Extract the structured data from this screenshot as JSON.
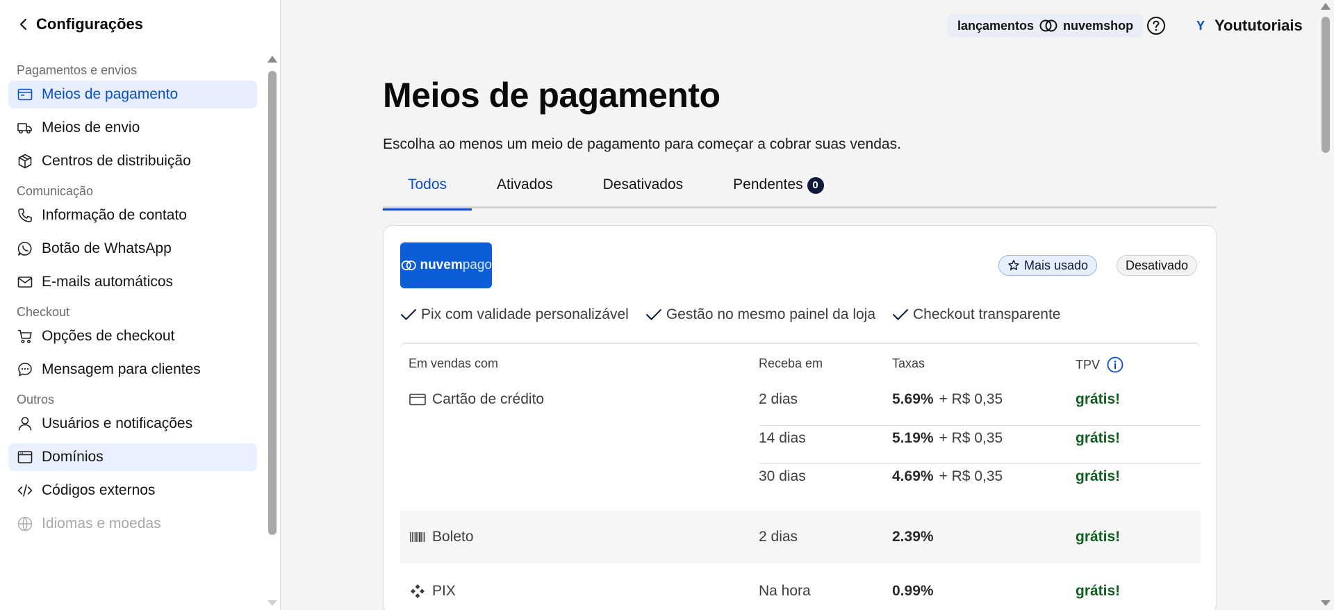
{
  "sidebar": {
    "header": "Configurações",
    "sections": [
      {
        "title": "Pagamentos e envios",
        "items": [
          {
            "label": "Meios de pagamento",
            "icon": "wallet-icon",
            "state": "active"
          },
          {
            "label": "Meios de envio",
            "icon": "truck-icon",
            "state": ""
          },
          {
            "label": "Centros de distribuição",
            "icon": "box-icon",
            "state": ""
          }
        ]
      },
      {
        "title": "Comunicação",
        "items": [
          {
            "label": "Informação de contato",
            "icon": "phone-icon",
            "state": ""
          },
          {
            "label": "Botão de WhatsApp",
            "icon": "whatsapp-icon",
            "state": ""
          },
          {
            "label": "E-mails automáticos",
            "icon": "mail-icon",
            "state": ""
          }
        ]
      },
      {
        "title": "Checkout",
        "items": [
          {
            "label": "Opções de checkout",
            "icon": "cart-icon",
            "state": ""
          },
          {
            "label": "Mensagem para clientes",
            "icon": "chat-icon",
            "state": ""
          }
        ]
      },
      {
        "title": "Outros",
        "items": [
          {
            "label": "Usuários e notificações",
            "icon": "user-icon",
            "state": ""
          },
          {
            "label": "Domínios",
            "icon": "browser-icon",
            "state": "hovered"
          },
          {
            "label": "Códigos externos",
            "icon": "code-icon",
            "state": ""
          },
          {
            "label": "Idiomas e moedas",
            "icon": "globe-icon",
            "state": "faded"
          }
        ]
      }
    ]
  },
  "topbar": {
    "badge_left": "lançamentos",
    "badge_right": "nuvemshop",
    "user_initial": "Y",
    "user_name": "Yoututoriais"
  },
  "main": {
    "title": "Meios de pagamento",
    "subtitle": "Escolha ao menos um meio de pagamento para começar a cobrar suas vendas.",
    "tabs": [
      {
        "label": "Todos",
        "active": true
      },
      {
        "label": "Ativados",
        "active": false
      },
      {
        "label": "Desativados",
        "active": false
      },
      {
        "label": "Pendentes",
        "active": false,
        "count": "0"
      }
    ],
    "card": {
      "logo_bold": "nuvem",
      "logo_light": "pago",
      "badge_popular": "Mais usado",
      "badge_status": "Desativado",
      "features": [
        "Pix com validade personalizável",
        "Gestão no mesmo painel da loja",
        "Checkout transparente"
      ],
      "table": {
        "headers": [
          "Em vendas com",
          "Receba em",
          "Taxas",
          "TPV"
        ],
        "rows": [
          {
            "method": "Cartão de crédito",
            "icon": "credit-card-icon",
            "days": "2 dias",
            "rate": "5.69%",
            "fee": " + R$ 0,35",
            "tpv": "grátis!"
          },
          {
            "method": "",
            "icon": "",
            "days": "14 dias",
            "rate": "5.19%",
            "fee": " + R$ 0,35",
            "tpv": "grátis!"
          },
          {
            "method": "",
            "icon": "",
            "days": "30 dias",
            "rate": "4.69%",
            "fee": " + R$ 0,35",
            "tpv": "grátis!"
          },
          {
            "method": "Boleto",
            "icon": "barcode-icon",
            "days": "2 dias",
            "rate": "2.39%",
            "fee": "",
            "tpv": "grátis!"
          },
          {
            "method": "PIX",
            "icon": "pix-icon",
            "days": "Na hora",
            "rate": "0.99%",
            "fee": "",
            "tpv": "grátis!"
          }
        ]
      }
    }
  },
  "colors": {
    "accent": "#0b4fc7",
    "free_green": "#0f5f1f",
    "logo_bg": "#0b5ed7"
  }
}
